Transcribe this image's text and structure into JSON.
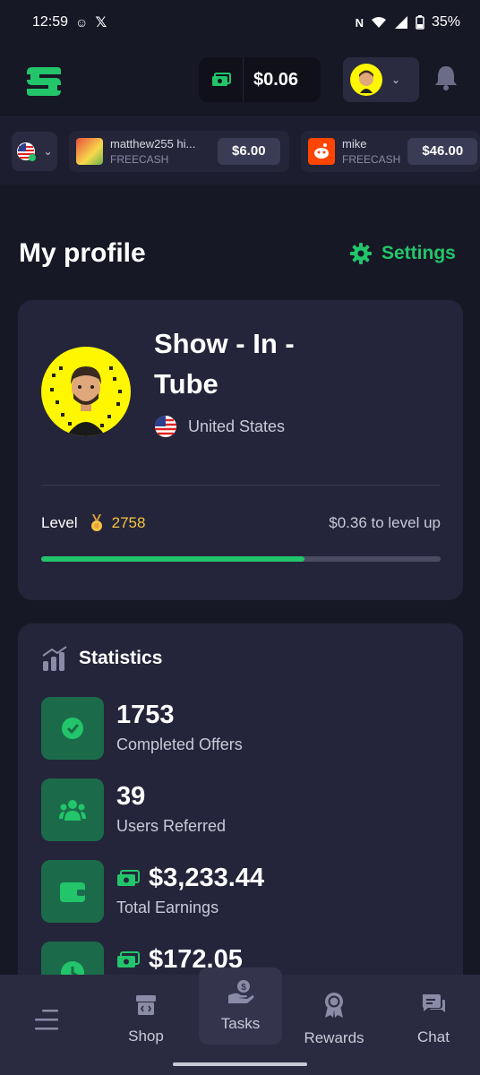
{
  "status_bar": {
    "time": "12:59",
    "battery": "35%"
  },
  "header": {
    "balance": "$0.06"
  },
  "ticker": [
    {
      "name": "matthew255 hi...",
      "source": "FREECASH",
      "amount": "$6.00"
    },
    {
      "name": "mike",
      "source": "FREECASH",
      "amount": "$46.00"
    }
  ],
  "page": {
    "title": "My profile",
    "settings_label": "Settings"
  },
  "profile": {
    "name": "Show - In - Tube",
    "country": "United States",
    "level_label": "Level",
    "level": "2758",
    "level_up_text": "$0.36 to level up",
    "progress": 0.66
  },
  "stats": {
    "title": "Statistics",
    "items": [
      {
        "value": "1753",
        "label": "Completed Offers",
        "icon": "badge-check-icon"
      },
      {
        "value": "39",
        "label": "Users Referred",
        "icon": "users-icon"
      },
      {
        "value": "$3,233.44",
        "label": "Total Earnings",
        "icon": "wallet-icon"
      },
      {
        "value": "$172.05",
        "label": "",
        "icon": "clock-icon"
      }
    ]
  },
  "nav": {
    "shop": "Shop",
    "tasks": "Tasks",
    "rewards": "Rewards",
    "chat": "Chat"
  },
  "colors": {
    "accent": "#23c56a",
    "background": "#171826",
    "card": "#24253a",
    "gold": "#f5c542"
  }
}
